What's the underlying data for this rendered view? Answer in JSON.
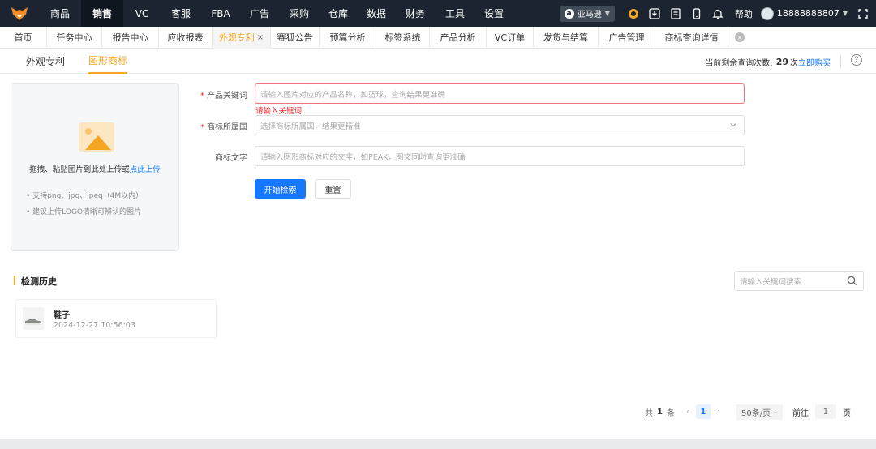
{
  "topnav": {
    "items": [
      "商品",
      "销售",
      "VC",
      "客服",
      "FBA",
      "广告",
      "采购",
      "仓库",
      "数据",
      "财务",
      "工具",
      "设置"
    ],
    "active_index": 1,
    "platform": "亚马逊",
    "help": "帮助",
    "user": "18888888807"
  },
  "tabs": {
    "items": [
      "首页",
      "任务中心",
      "报告中心",
      "应收报表",
      "外观专利",
      "赛狐公告",
      "预算分析",
      "标签系统",
      "产品分析",
      "VC订单",
      "发货与结算",
      "广告管理",
      "商标查询详情"
    ],
    "active_index": 4
  },
  "subtabs": {
    "items": [
      "外观专利",
      "图形商标"
    ],
    "active_index": 1,
    "quota_label": "当前剩余查询次数:",
    "quota_count": "29",
    "quota_unit": "次",
    "buy_link": "立即购买"
  },
  "upload": {
    "main_text": "拖拽、粘贴图片到此处上传或",
    "link_text": "点此上传",
    "tip1": "支持png、jpg、jpeg（4M以内）",
    "tip2": "建议上传LOGO清晰可辨认的图片"
  },
  "form": {
    "keyword_label": "产品关键词",
    "keyword_placeholder": "请输入图片对应的产品名称，如篮球，查询结果更准确",
    "keyword_error": "请输入关键词",
    "country_label": "商标所属国",
    "country_placeholder": "选择商标所属国，结果更精准",
    "text_label": "商标文字",
    "text_placeholder": "请输入图形商标对应的文字，如PEAK，图文同时查询更准确",
    "search_button": "开始检索",
    "reset_button": "重置"
  },
  "history": {
    "title": "检测历史",
    "search_placeholder": "请输入关键词搜索",
    "items": [
      {
        "name": "鞋子",
        "time": "2024-12-27 10:56:03"
      }
    ]
  },
  "pagination": {
    "total_prefix": "共",
    "total": "1",
    "total_suffix": "条",
    "current_page": "1",
    "page_size": "50条/页",
    "goto_label": "前往",
    "goto_value": "1",
    "goto_suffix": "页"
  },
  "colors": {
    "accent": "#f5a623",
    "primary": "#1677ff",
    "error": "#f5222d",
    "topbar": "#1b2430"
  }
}
